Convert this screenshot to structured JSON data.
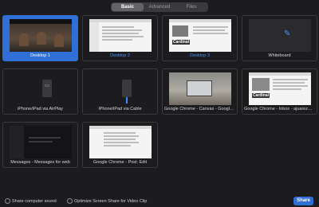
{
  "tabs": [
    {
      "label": "Basic",
      "active": true
    },
    {
      "label": "Advanced",
      "active": false
    },
    {
      "label": "Files",
      "active": false
    }
  ],
  "sources": [
    {
      "label": "Desktop 1",
      "icon": "desktop-icon",
      "selected": true
    },
    {
      "label": "Desktop 2",
      "icon": "desktop-icon",
      "selected": false
    },
    {
      "label": "Desktop 3",
      "icon": "desktop-icon",
      "selected": false
    },
    {
      "label": "Whiteboard",
      "icon": "pencil-icon",
      "selected": false
    },
    {
      "label": "iPhone/iPad via AirPlay",
      "icon": "airplay-icon",
      "selected": false
    },
    {
      "label": "iPhone/iPad via Cable",
      "icon": "cable-icon",
      "selected": false
    },
    {
      "label": "Google Chrome - Canvas - Google...",
      "icon": "window-icon",
      "selected": false
    },
    {
      "label": "Google Chrome - Inbox - ajuarez@...",
      "icon": "window-icon",
      "selected": false
    },
    {
      "label": "Messages - Messages for web",
      "icon": "window-icon",
      "selected": false
    },
    {
      "label": "Google Chrome - Post: Edit",
      "icon": "window-icon",
      "selected": false
    }
  ],
  "thumb_text": {
    "cardinal": "Cardinal"
  },
  "footer": {
    "share_sound": "Share computer sound",
    "optimize_clip": "Optimize Screen Share for Video Clip",
    "share_button": "Share"
  },
  "colors": {
    "accent": "#2f6fd6",
    "background": "#1c1c1e"
  }
}
